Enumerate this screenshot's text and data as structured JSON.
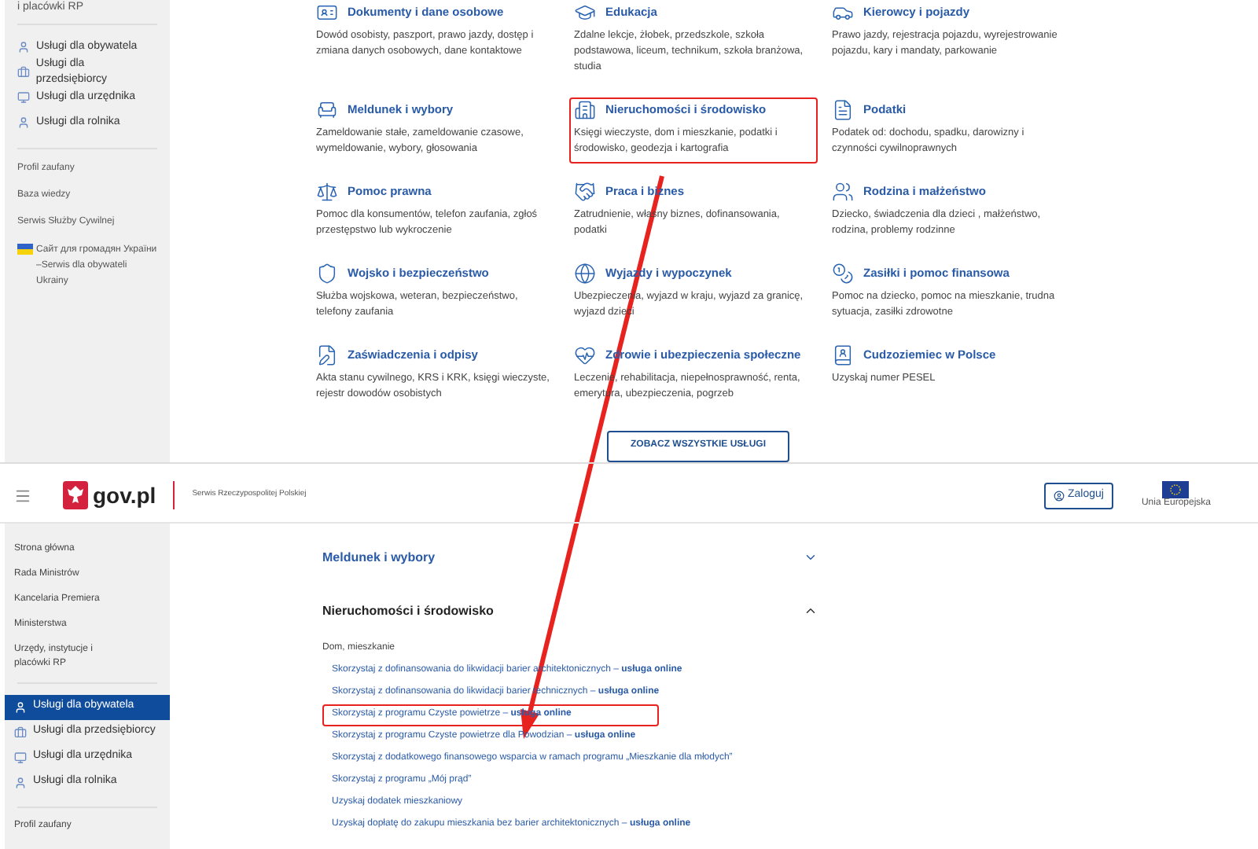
{
  "top_page": {
    "sidebar": {
      "cut_item": "i placówki RP",
      "services": [
        {
          "label": "Usługi dla obywatela"
        },
        {
          "label": "Usługi dla przedsiębiorcy"
        },
        {
          "label": "Usługi dla urzędnika"
        },
        {
          "label": "Usługi dla rolnika"
        }
      ],
      "links": [
        "Profil zaufany",
        "Baza wiedzy",
        "Serwis Służby Cywilnej"
      ],
      "ukraine_link": "Сайт для громадян України –Serwis dla obywateli Ukrainy"
    },
    "categories": [
      {
        "title": "Dokumenty i dane osobowe",
        "description": "Dowód osobisty, paszport, prawo jazdy, dostęp i zmiana danych osobowych, dane kontaktowe",
        "highlighted": false
      },
      {
        "title": "Edukacja",
        "description": "Zdalne lekcje, żłobek, przedszkole, szkoła podstawowa, liceum, technikum, szkoła branżowa, studia",
        "highlighted": false
      },
      {
        "title": "Kierowcy i pojazdy",
        "description": "Prawo jazdy, rejestracja pojazdu, wyrejestrowanie pojazdu, kary i mandaty, parkowanie",
        "highlighted": false
      },
      {
        "title": "Meldunek i wybory",
        "description": "Zameldowanie stałe, zameldowanie czasowe, wymeldowanie, wybory, głosowania",
        "highlighted": false
      },
      {
        "title": "Nieruchomości i środowisko",
        "description": "Księgi wieczyste, dom i mieszkanie, podatki i środowisko, geodezja i kartografia",
        "highlighted": true
      },
      {
        "title": "Podatki",
        "description": "Podatek od: dochodu, spadku, darowizny i czynności cywilnoprawnych",
        "highlighted": false
      },
      {
        "title": "Pomoc prawna",
        "description": "Pomoc dla konsumentów, telefon zaufania, zgłoś przestępstwo lub wykroczenie",
        "highlighted": false
      },
      {
        "title": "Praca i biznes",
        "description": "Zatrudnienie, własny biznes, dofinansowania, podatki",
        "highlighted": false
      },
      {
        "title": "Rodzina i małżeństwo",
        "description": "Dziecko, świadczenia dla dzieci , małżeństwo, rodzina, problemy rodzinne",
        "highlighted": false
      },
      {
        "title": "Wojsko i bezpieczeństwo",
        "description": "Służba wojskowa, weteran, bezpieczeństwo, telefony zaufania",
        "highlighted": false
      },
      {
        "title": "Wyjazdy i wypoczynek",
        "description": "Ubezpieczenia, wyjazd w kraju, wyjazd za granicę, wyjazd dzieci",
        "highlighted": false
      },
      {
        "title": "Zasiłki i pomoc finansowa",
        "description": "Pomoc na dziecko, pomoc na mieszkanie, trudna sytuacja, zasiłki zdrowotne",
        "highlighted": false
      },
      {
        "title": "Zaświadczenia i odpisy",
        "description": "Akta stanu cywilnego, KRS i KRK, księgi wieczyste, rejestr dowodów osobistych",
        "highlighted": false
      },
      {
        "title": "Zdrowie i ubezpieczenia społeczne",
        "description": "Leczenie, rehabilitacja, niepełnosprawność, renta, emerytura, ubezpieczenia, pogrzeb",
        "highlighted": false
      },
      {
        "title": "Cudzoziemiec w Polsce",
        "description": "Uzyskaj numer PESEL",
        "highlighted": false
      }
    ],
    "all_services_button": "ZOBACZ WSZYSTKIE USŁUGI"
  },
  "bottom_page": {
    "header": {
      "site_name": "gov.pl",
      "subtitle": "Serwis Rzeczypospolitej Polskiej",
      "login_button": "Zaloguj",
      "eu_label": "Unia Europejska"
    },
    "sidebar": {
      "nav": [
        "Strona główna",
        "Rada Ministrów",
        "Kancelaria Premiera",
        "Ministerstwa",
        "Urzędy, instytucje i placówki RP"
      ],
      "services": [
        {
          "label": "Usługi dla obywatela",
          "selected": true
        },
        {
          "label": "Usługi dla przedsiębiorcy",
          "selected": false
        },
        {
          "label": "Usługi dla urzędnika",
          "selected": false
        },
        {
          "label": "Usługi dla rolnika",
          "selected": false
        }
      ],
      "links": [
        "Profil zaufany"
      ]
    },
    "accordions": [
      {
        "title": "Meldunek i wybory",
        "expanded": false
      },
      {
        "title": "Nieruchomości i środowisko",
        "expanded": true,
        "sections": [
          {
            "heading": "Dom, mieszkanie",
            "links": [
              {
                "text": "Skorzystaj z dofinansowania do likwidacji barier architektonicznych – **usługa online**",
                "highlighted": false
              },
              {
                "text": "Skorzystaj z dofinansowania do likwidacji barier technicznych – **usługa online**",
                "highlighted": false
              },
              {
                "text": "Skorzystaj z programu Czyste powietrze – **usługa online**",
                "highlighted": true
              },
              {
                "text": "Skorzystaj z programu Czyste powietrze dla Powodzian – **usługa online**",
                "highlighted": false
              },
              {
                "text": "Skorzystaj z dodatkowego finansowego wsparcia w ramach programu „Mieszkanie dla młodych”",
                "highlighted": false
              },
              {
                "text": "Skorzystaj z programu „Mój prąd”",
                "highlighted": false
              },
              {
                "text": "Uzyskaj dodatek mieszkaniowy",
                "highlighted": false
              },
              {
                "text": "Uzyskaj dopłatę do zakupu mieszkania bez barier architektonicznych – **usługa online**",
                "highlighted": false
              }
            ]
          }
        ]
      }
    ]
  }
}
